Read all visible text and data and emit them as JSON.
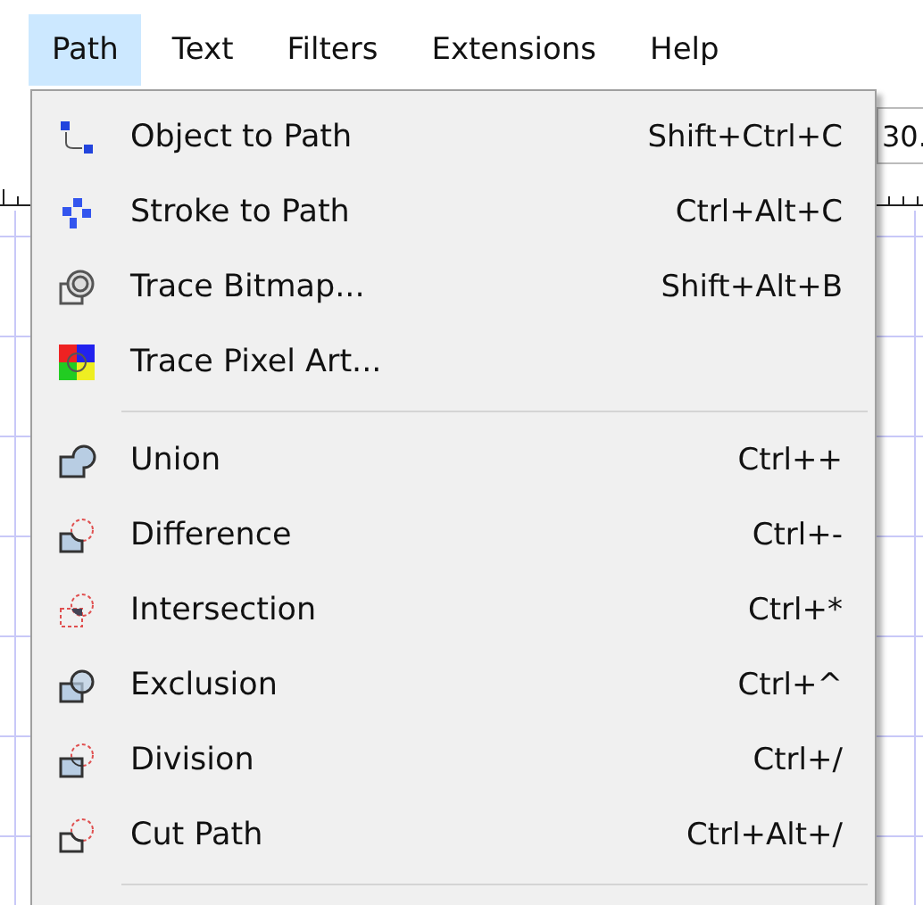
{
  "menubar": [
    {
      "label": "Path",
      "selected": true
    },
    {
      "label": "Text",
      "selected": false
    },
    {
      "label": "Filters",
      "selected": false
    },
    {
      "label": "Extensions",
      "selected": false
    },
    {
      "label": "Help",
      "selected": false
    }
  ],
  "toolbar": {
    "field_value": "30."
  },
  "menu": {
    "groups": [
      [
        {
          "label": "Object to Path",
          "shortcut": "Shift+Ctrl+C"
        },
        {
          "label": "Stroke to Path",
          "shortcut": "Ctrl+Alt+C"
        },
        {
          "label": "Trace Bitmap...",
          "shortcut": "Shift+Alt+B"
        },
        {
          "label": "Trace Pixel Art..."
        }
      ],
      [
        {
          "label": "Union",
          "shortcut": "Ctrl++"
        },
        {
          "label": "Difference",
          "shortcut": "Ctrl+-"
        },
        {
          "label": "Intersection",
          "shortcut": "Ctrl+*"
        },
        {
          "label": "Exclusion",
          "shortcut": "Ctrl+^"
        },
        {
          "label": "Division",
          "shortcut": "Ctrl+/"
        },
        {
          "label": "Cut Path",
          "shortcut": "Ctrl+Alt+/"
        }
      ]
    ]
  }
}
